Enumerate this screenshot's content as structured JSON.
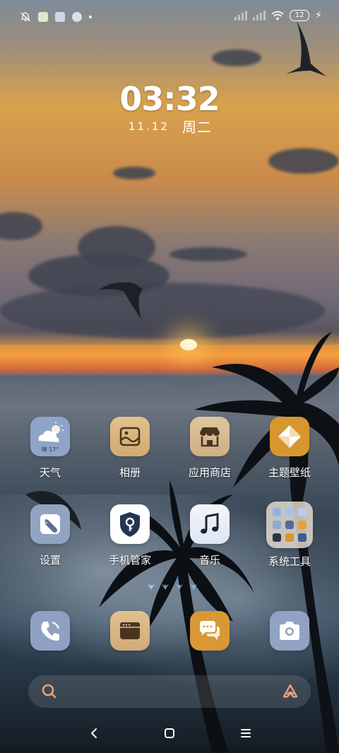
{
  "statusbar": {
    "battery": "12",
    "icons": [
      "bell-off-icon",
      "app-notification-icon",
      "app-notification-icon",
      "app-notification-icon",
      "signal-icon",
      "wifi-icon",
      "battery-icon",
      "charging-icon"
    ]
  },
  "clock": {
    "time": "03:32",
    "date": "11.12",
    "weekday": "周二"
  },
  "apps": [
    {
      "label": "天气",
      "icon": "weather-icon",
      "weather_text": "晴 17°"
    },
    {
      "label": "相册",
      "icon": "gallery-icon"
    },
    {
      "label": "应用商店",
      "icon": "app-store-icon"
    },
    {
      "label": "主题壁纸",
      "icon": "themes-icon"
    },
    {
      "label": "设置",
      "icon": "settings-icon"
    },
    {
      "label": "手机管家",
      "icon": "security-icon"
    },
    {
      "label": "音乐",
      "icon": "music-icon"
    },
    {
      "label": "系统工具",
      "icon": "folder-icon"
    }
  ],
  "dock": [
    {
      "icon": "phone-icon"
    },
    {
      "icon": "browser-icon"
    },
    {
      "icon": "messages-icon"
    },
    {
      "icon": "camera-icon"
    }
  ],
  "search": {
    "icon": "search-icon",
    "assistant_icon": "assistant-icon"
  },
  "nav": {
    "back": "back-icon",
    "home": "home-icon",
    "recents": "menu-icon"
  },
  "colors": {
    "weather_bg": "#8ea4c8",
    "gallery_bg": "#d9b680",
    "store_bg": "#d7b98d",
    "themes_bg": "#d8962e",
    "settings_bg": "#93a3c4",
    "security_bg": "#ffffff",
    "music_bg": "#e7edf7",
    "folder_bg": "#e1dcd3",
    "phone_bg": "#8fa1c2",
    "browser_bg": "#dab58a",
    "messages_bg": "#d89835",
    "camera_bg": "#92a2c3"
  }
}
